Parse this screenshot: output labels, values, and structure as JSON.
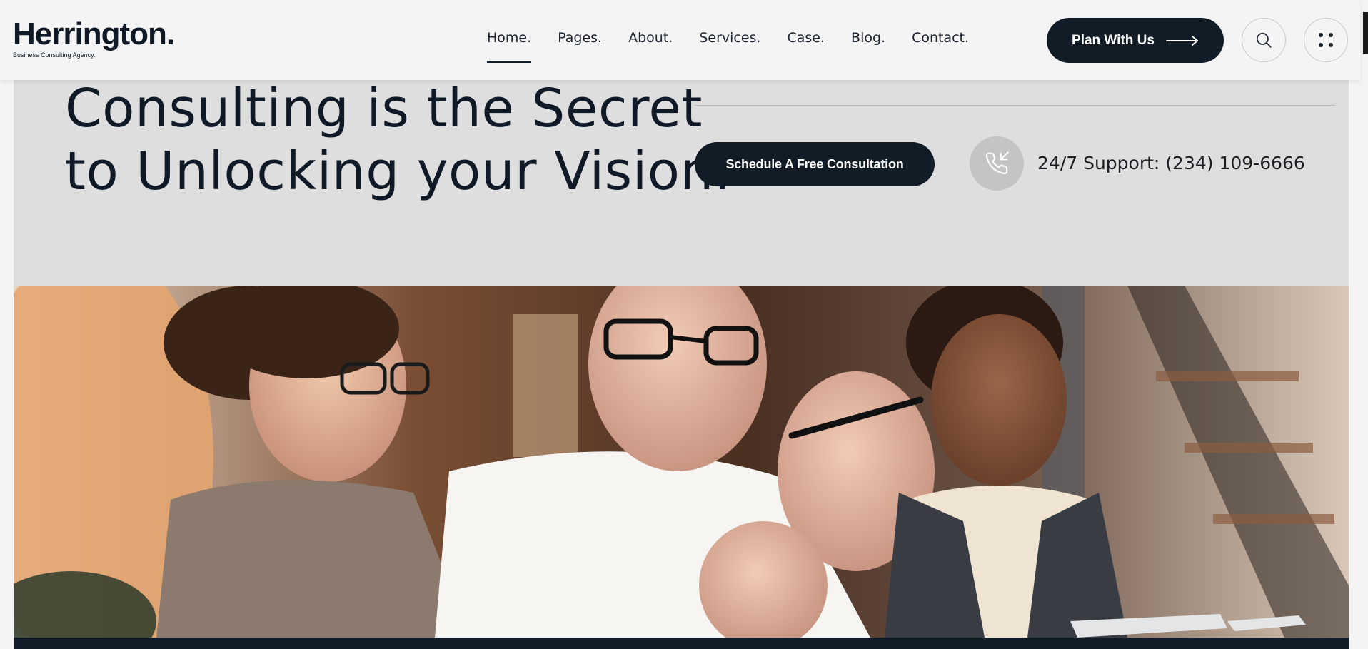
{
  "header": {
    "logo": {
      "name": "Herrington.",
      "tagline": "Business Consulting Agency."
    },
    "nav": [
      {
        "label": "Home.",
        "active": true
      },
      {
        "label": "Pages."
      },
      {
        "label": "About."
      },
      {
        "label": "Services."
      },
      {
        "label": "Case."
      },
      {
        "label": "Blog."
      },
      {
        "label": "Contact."
      }
    ],
    "plan_button": "Plan With Us",
    "icons": {
      "search": "search-icon",
      "menu": "grid-dots-icon",
      "arrow": "arrow-right-icon"
    }
  },
  "hero": {
    "headline_line1": "Consulting is the Secret",
    "headline_line2": "to Unlocking your Vision.",
    "cta_button": "Schedule A Free Consultation",
    "support_text": "24/7 Support: (234) 109-6666",
    "phone_icon": "phone-incoming-icon"
  },
  "colors": {
    "brand_dark": "#111c27",
    "hero_bg": "#dedede",
    "page_bg": "#f4f4f4",
    "phone_circle": "#c4c4c4"
  }
}
